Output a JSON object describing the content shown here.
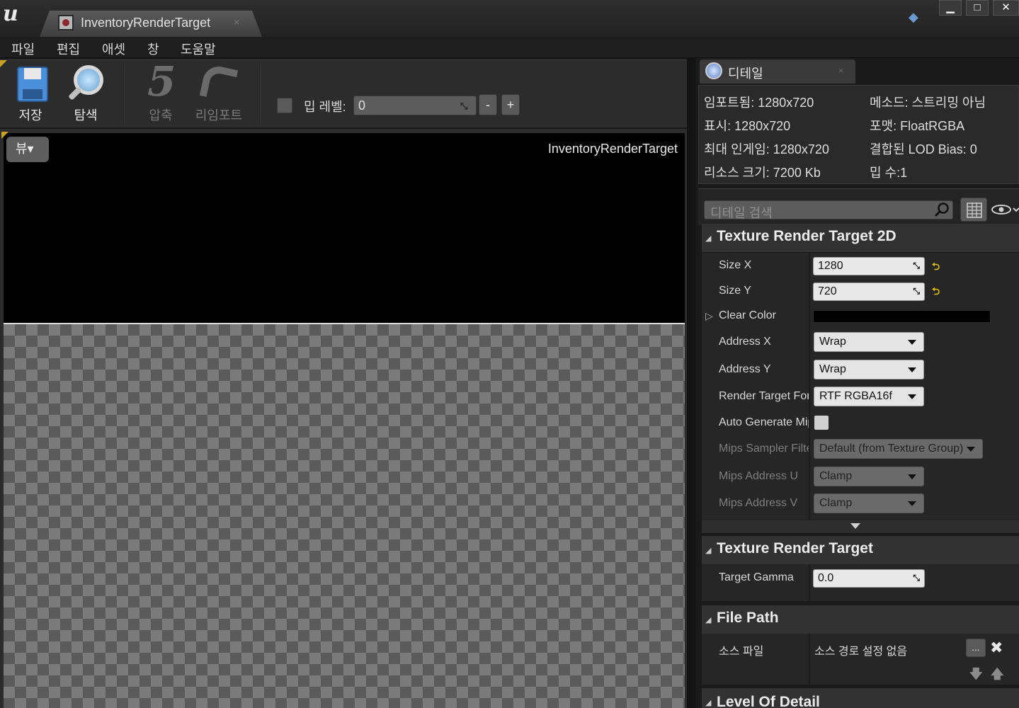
{
  "window": {
    "tab_title": "InventoryRenderTarget",
    "tab_close": "×",
    "logo": "u",
    "minimize": "▁",
    "maximize": "□",
    "close": "✕"
  },
  "menu": [
    "파일",
    "편집",
    "애셋",
    "창",
    "도움말"
  ],
  "toolbar": {
    "save_label": "저장",
    "browse_label": "탐색",
    "compress_label": "압축",
    "reimport_label": "리임포트",
    "mip_level_label": "밉 레벨:",
    "mip_level_value": "0",
    "mip_minus": "-",
    "mip_plus": "+"
  },
  "viewport": {
    "view_button": "뷰▾",
    "title": "InventoryRenderTarget"
  },
  "details": {
    "tab_label": "디테일",
    "info_left": [
      "임포트됨: 1280x720",
      "표시: 1280x720",
      "최대 인게임: 1280x720",
      "리소스 크기: 7200 Kb"
    ],
    "info_right": [
      "메소드: 스트리밍 아님",
      "포맷: FloatRGBA",
      "결합된 LOD Bias: 0",
      "밉 수:1"
    ],
    "search_placeholder": "디테일 검색",
    "categories": {
      "trt2d": "Texture Render Target 2D",
      "trt": "Texture Render Target",
      "file_path": "File Path",
      "lod": "Level Of Detail"
    },
    "props": {
      "size_x_label": "Size X",
      "size_x_value": "1280",
      "size_y_label": "Size Y",
      "size_y_value": "720",
      "clear_color_label": "Clear Color",
      "address_x_label": "Address X",
      "address_x_value": "Wrap",
      "address_y_label": "Address Y",
      "address_y_value": "Wrap",
      "rt_format_label": "Render Target Format",
      "rt_format_value": "RTF RGBA16f",
      "auto_mips_label": "Auto Generate Mips",
      "mips_filter_label": "Mips Sampler Filter",
      "mips_filter_value": "Default (from Texture Group)",
      "mips_addr_u_label": "Mips Address U",
      "mips_addr_u_value": "Clamp",
      "mips_addr_v_label": "Mips Address V",
      "mips_addr_v_value": "Clamp",
      "target_gamma_label": "Target Gamma",
      "target_gamma_value": "0.0",
      "source_file_label": "소스 파일",
      "source_file_value": "소스 경로 설정 없음",
      "source_dots": "..."
    }
  },
  "colors": {
    "accent_yellow": "#c8a020",
    "reset_yellow": "#e0c000",
    "panel_bg": "#262626"
  }
}
